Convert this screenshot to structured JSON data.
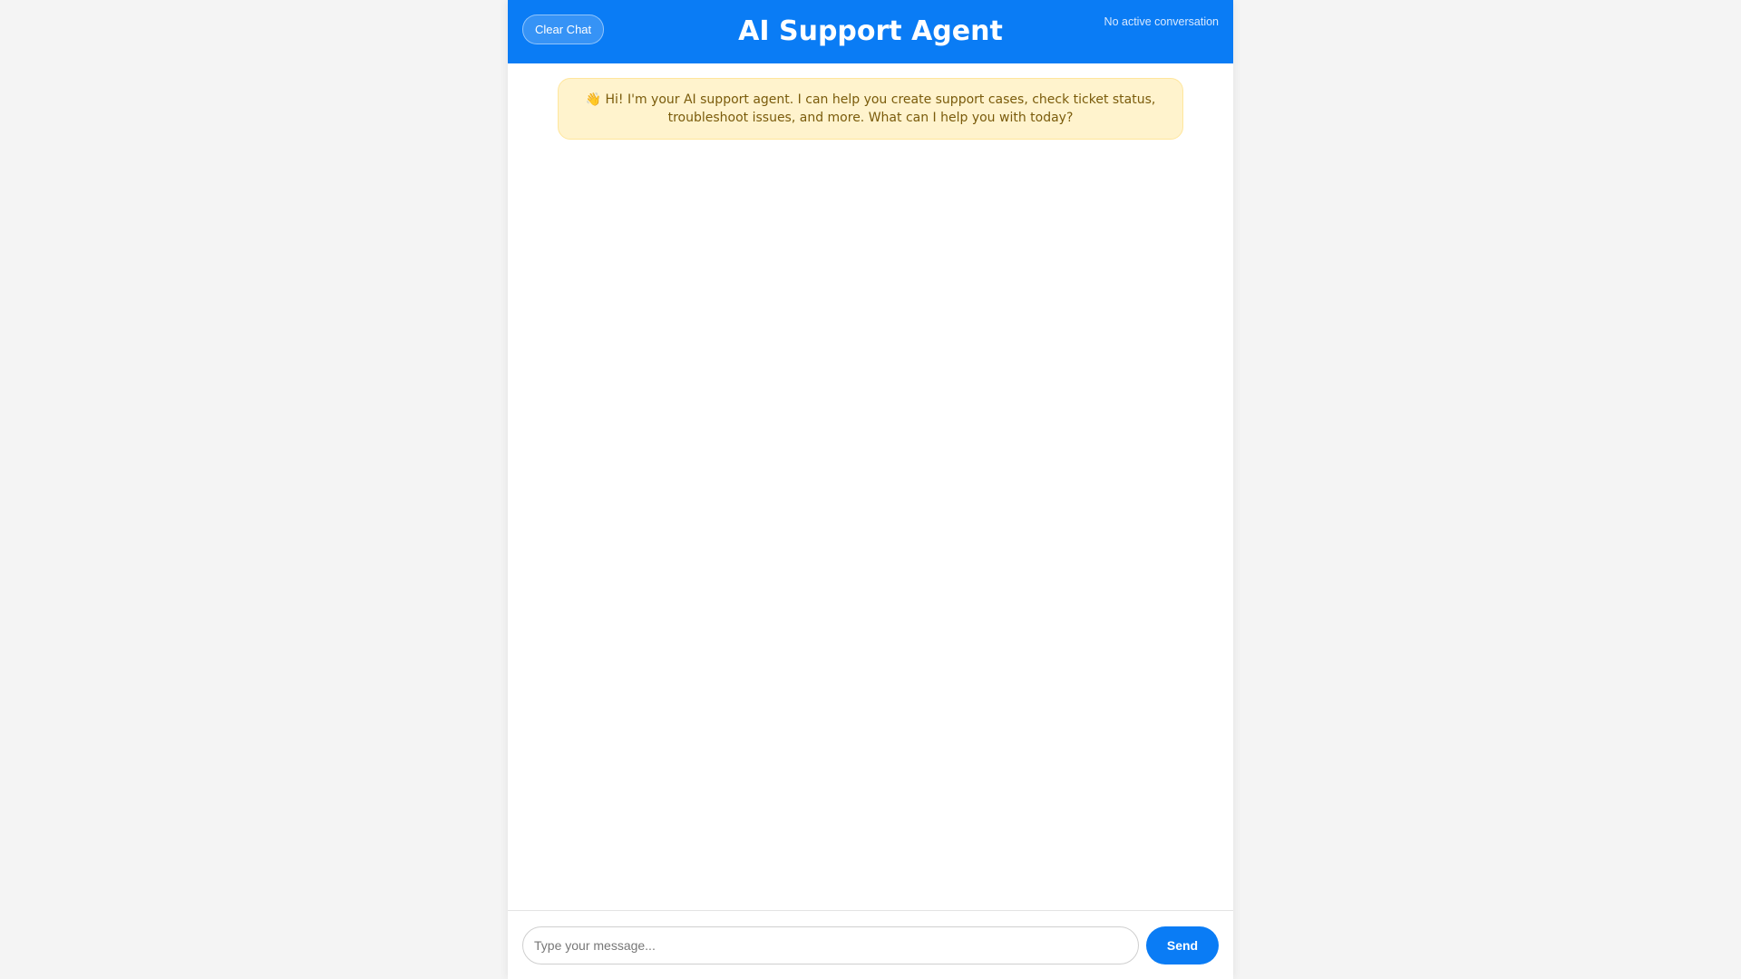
{
  "header": {
    "clear_button_label": "Clear Chat",
    "title": "AI Support Agent",
    "status_text": "No active conversation"
  },
  "chat": {
    "welcome_message": "👋 Hi! I'm your AI support agent. I can help you create support cases, check ticket status, troubleshoot issues, and more. What can I help you with today?"
  },
  "composer": {
    "input_value": "",
    "input_placeholder": "Type your message...",
    "send_label": "Send"
  },
  "colors": {
    "accent": "#0a7cf5",
    "welcome_bg": "#fff3cd",
    "welcome_text": "#7a5b0b",
    "page_bg": "#f4f4f4"
  }
}
